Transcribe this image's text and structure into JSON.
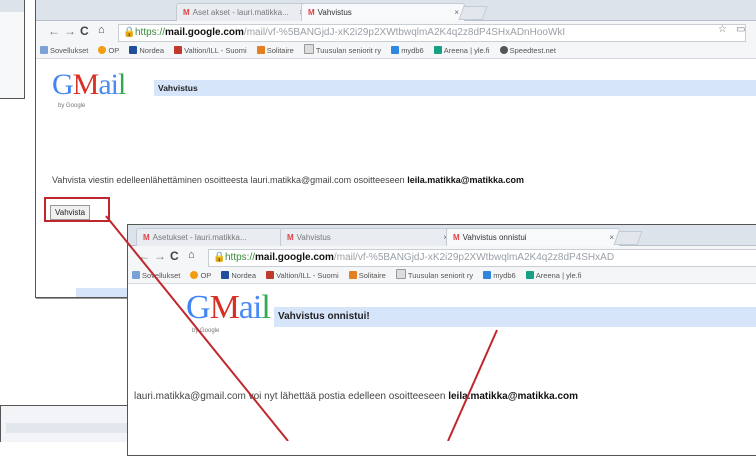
{
  "window1": {
    "tabs": [
      {
        "label": "Aset akset - lauri.matikka..."
      },
      {
        "label": "Vahvistus"
      }
    ],
    "url": {
      "scheme": "https://",
      "host": "mail.google.com",
      "path": "/mail/vf-%5BANGjdJ-xK2i29p2XWtbwqlmA2K4q2z8dP4SHxADnHooWkI"
    },
    "bookmarks": [
      "Sovellukset",
      "OP",
      "Nordea",
      "Valtion/ILL - Suomi",
      "Solitaire",
      "Tuusulan seniorit ry",
      "mydb6",
      "Areena | yle.fi",
      "Speedtest.net"
    ],
    "logo": {
      "g": "G",
      "m": "M",
      "ai": "ai",
      "l": "l"
    },
    "by_google": "by Google",
    "title": "Vahvistus",
    "message_prefix": "Vahvista viestin edelleenlähettäminen osoitteesta lauri.matikka@gmail.com osoitteeseen",
    "message_email": "leila.matikka@matikka.com",
    "button_label": "Vahvista"
  },
  "window2": {
    "tabs": [
      {
        "label": "Asetukset - lauri.matikka..."
      },
      {
        "label": "Vahvistus"
      },
      {
        "label": "Vahvistus onnistui"
      }
    ],
    "url": {
      "scheme": "https://",
      "host": "mail.google.com",
      "path": "/mail/vf-%5BANGjdJ-xK2i29p2XWtbwqlmA2K4q2z8dP4SHxAD"
    },
    "bookmarks": [
      "Sovellukset",
      "OP",
      "Nordea",
      "Valtion/ILL - Suomi",
      "Solitaire",
      "Tuusulan seniorit ry",
      "mydb6",
      "Areena | yle.fi"
    ],
    "logo": {
      "g": "G",
      "m": "M",
      "ai": "ai",
      "l": "l"
    },
    "by_google": "by Google",
    "title": "Vahvistus onnistui!",
    "message_prefix": "lauri.matikka@gmail.com voi nyt lähettää postia edelleen osoitteeseen",
    "message_email": "leila.matikka@matikka.com"
  },
  "colors": {
    "annotation": "#c0272d",
    "gmail_bar": "#d7e5fb"
  }
}
